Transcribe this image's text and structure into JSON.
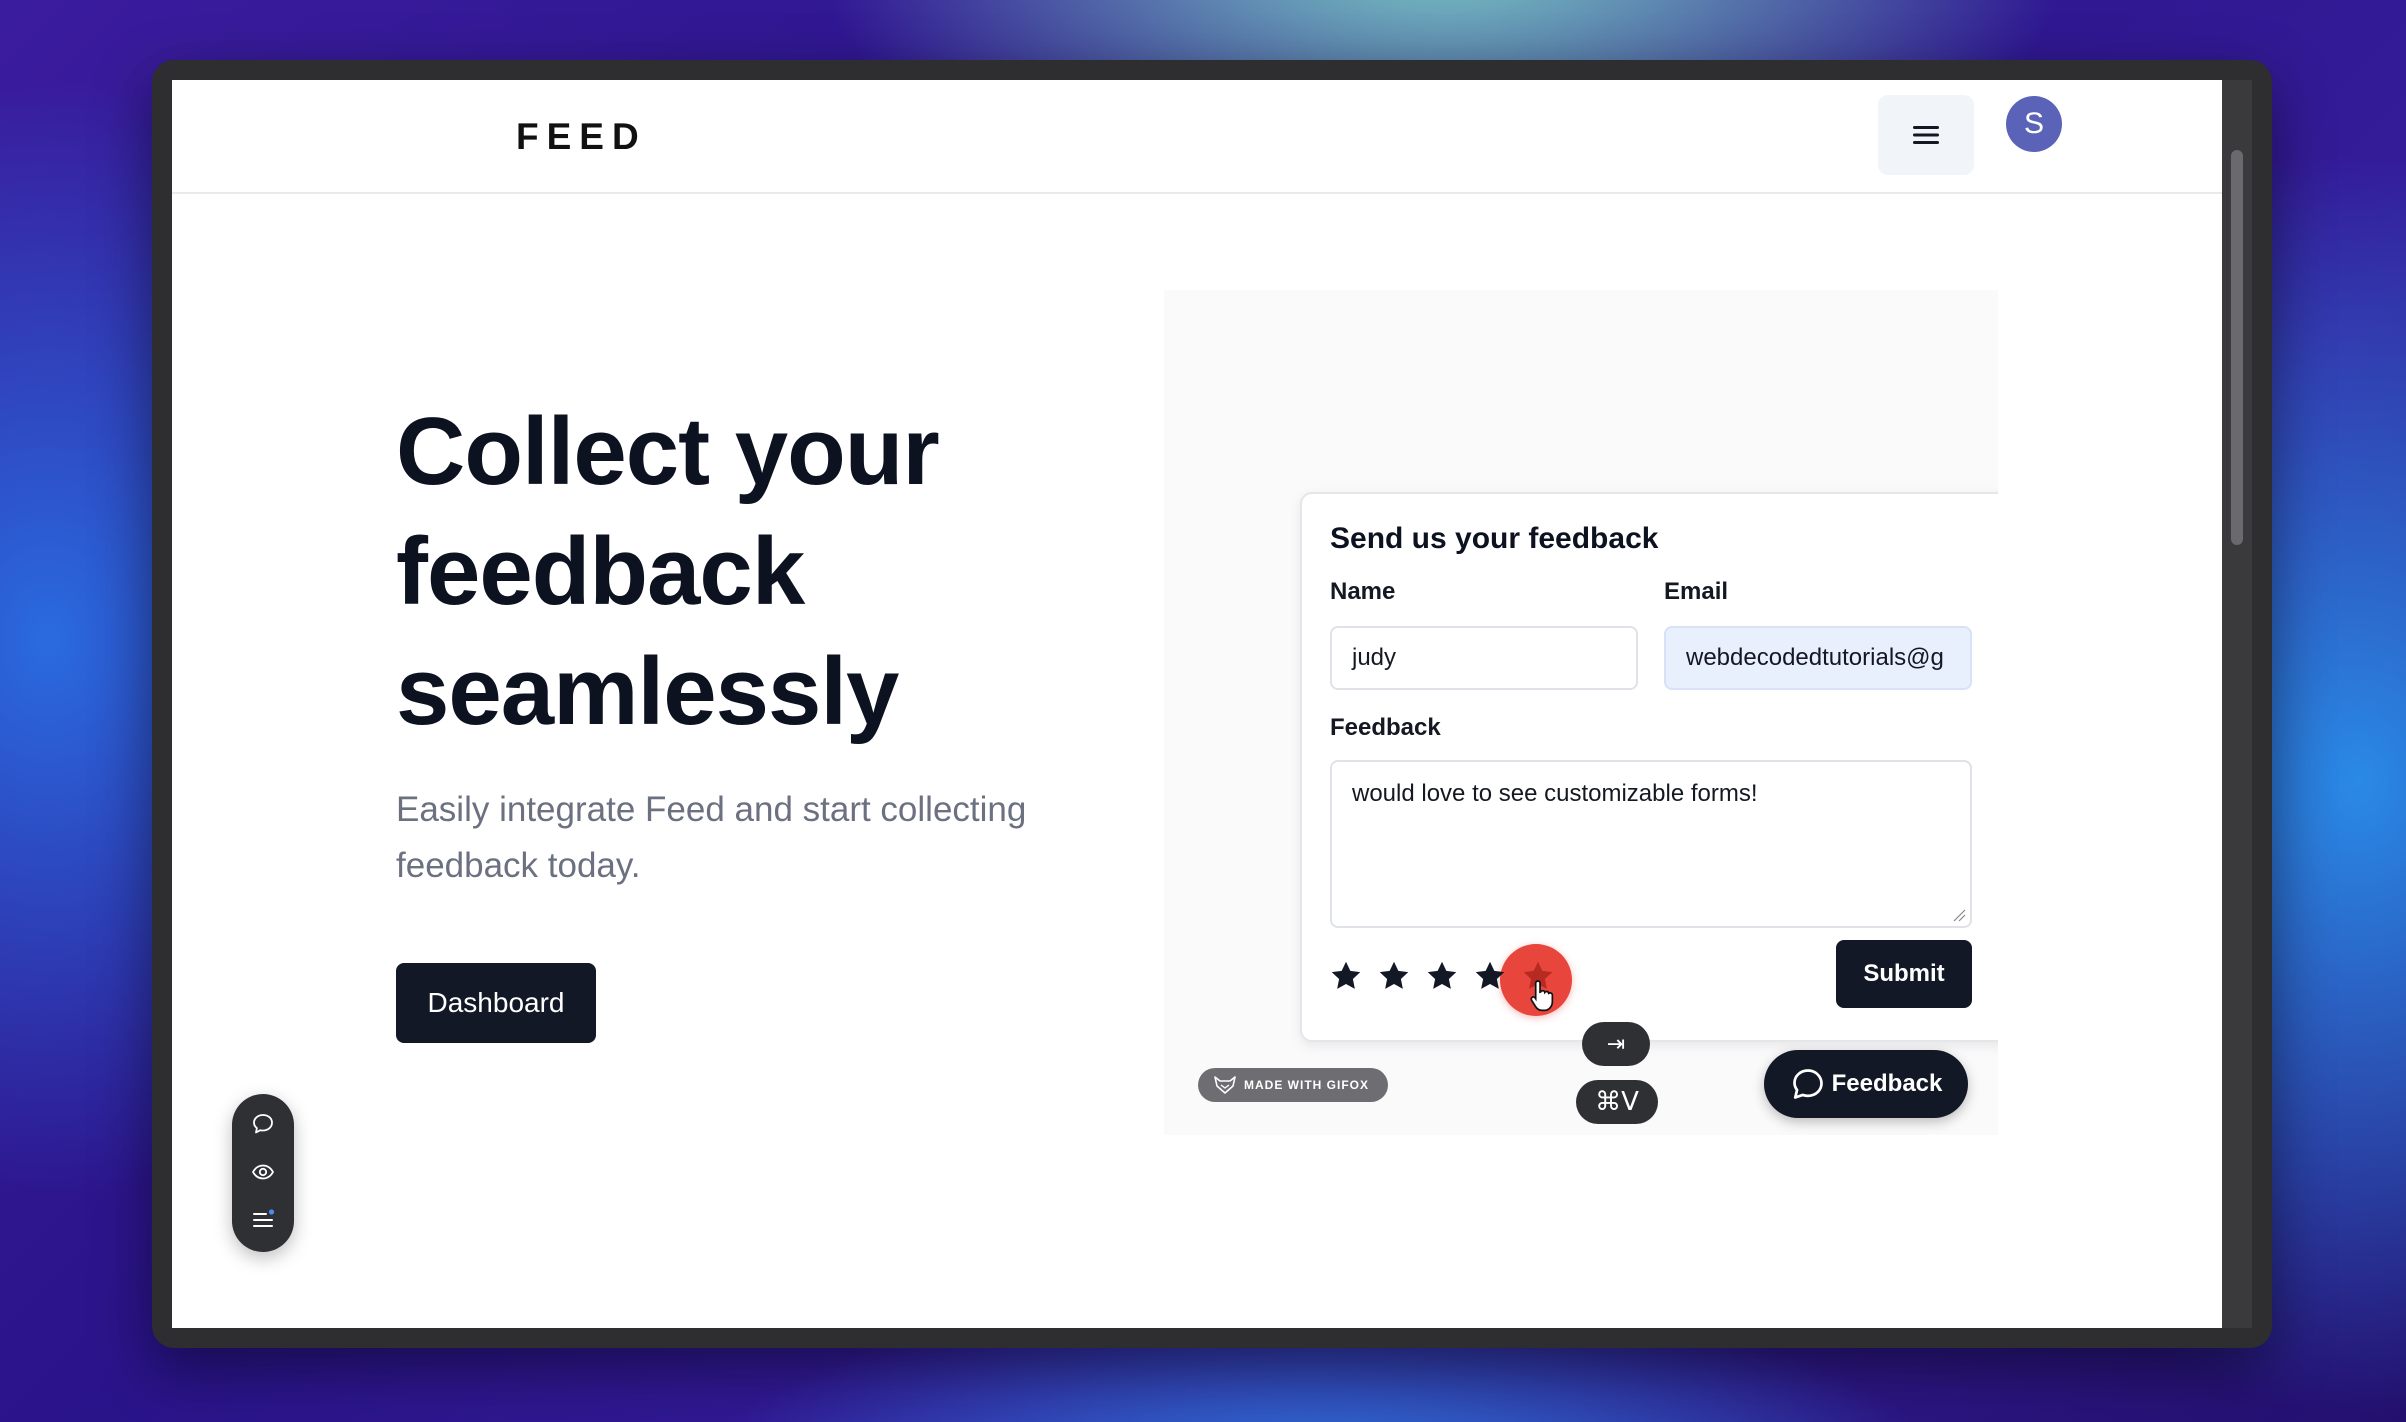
{
  "app": {
    "logo": "FEED",
    "avatar_initial": "S"
  },
  "hero": {
    "title": "Collect your feedback seamlessly",
    "subtitle": "Easily integrate Feed and start collecting feedback today.",
    "dashboard_label": "Dashboard"
  },
  "feedback_form": {
    "title": "Send us your feedback",
    "name_label": "Name",
    "name_value": "judy",
    "email_label": "Email",
    "email_value": "webdecodedtutorials@g",
    "feedback_label": "Feedback",
    "feedback_value": "would love to see customizable forms!",
    "rating": 5,
    "rating_max": 5,
    "submit_label": "Submit"
  },
  "overlays": {
    "tab_key": "⇥",
    "paste_key": "⌘V",
    "gifox_badge": "MADE WITH GIFOX",
    "feedback_button": "Feedback"
  },
  "colors": {
    "primary_dark": "#131827",
    "avatar": "#5b63b8",
    "cursor_highlight": "#e8453c",
    "autofill": "#e8effd"
  },
  "icons": {
    "menu": "hamburger-icon",
    "toolbar": [
      "chat-bubble-icon",
      "eye-icon",
      "list-icon"
    ],
    "feedback_button": "chat-bubble-icon",
    "rating": "star-icon"
  }
}
